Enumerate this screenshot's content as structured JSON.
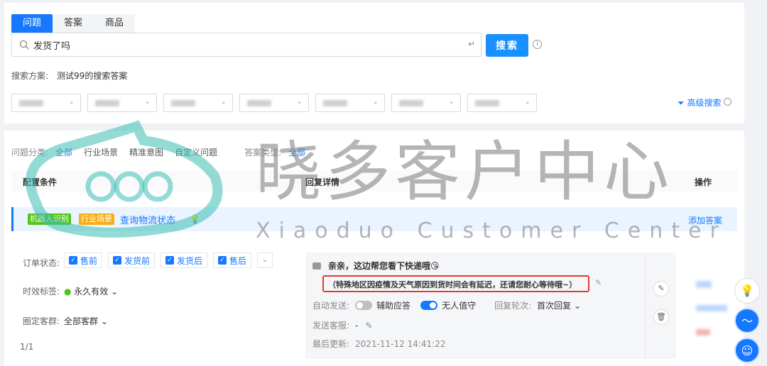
{
  "tabs": [
    "问题",
    "答案",
    "商品"
  ],
  "search": {
    "value": "发货了吗",
    "enter_symbol": "↵",
    "button_label": "搜索",
    "info_symbol": "i"
  },
  "scheme": {
    "label": "搜索方案:",
    "value": "测试99的搜索答案"
  },
  "advanced_search_label": "高级搜索",
  "categories": {
    "label": "问题分类:",
    "items": [
      "全部",
      "行业场景",
      "精准意图",
      "自定义问题"
    ],
    "type_label": "答案类型:",
    "type_value": "全部"
  },
  "table_headers": {
    "condition": "配置条件",
    "reply": "回复详情",
    "operation": "操作"
  },
  "row": {
    "tag_robot": "机器人识别",
    "tag_industry": "行业场景",
    "title": "查询物流状态",
    "add_answer": "添加答案"
  },
  "conditions": {
    "order_status_label": "订单状态:",
    "order_status_options": [
      "售前",
      "发货前",
      "发货后",
      "售后"
    ],
    "timeliness_label": "时效标签:",
    "timeliness_value": "永久有效",
    "crowd_label": "圈定客群:",
    "crowd_value": "全部客群"
  },
  "reply": {
    "message_1": "亲亲，这边帮您看下快递哦😘",
    "message_2": "（特殊地区因疫情及天气原因到货时间会有延迟，还请您耐心等待哦~）",
    "auto_send_label": "自动发送:",
    "assist_label": "辅助应答",
    "unmanned_label": "无人值守",
    "round_label": "回复轮次:",
    "round_value": "首次回复",
    "service_label": "发送客服:",
    "service_value": "-",
    "updated_label": "最后更新:",
    "updated_value": "2021-11-12 14:41:22"
  },
  "pager": "1/1",
  "watermark": {
    "title": "晓多客户中心",
    "subtitle": "Xiaoduo Customer Center"
  },
  "colors": {
    "primary": "#1677ff",
    "robot_tag": "#52c41a",
    "industry_tag": "#faad14",
    "highlight_border": "#e53935"
  }
}
